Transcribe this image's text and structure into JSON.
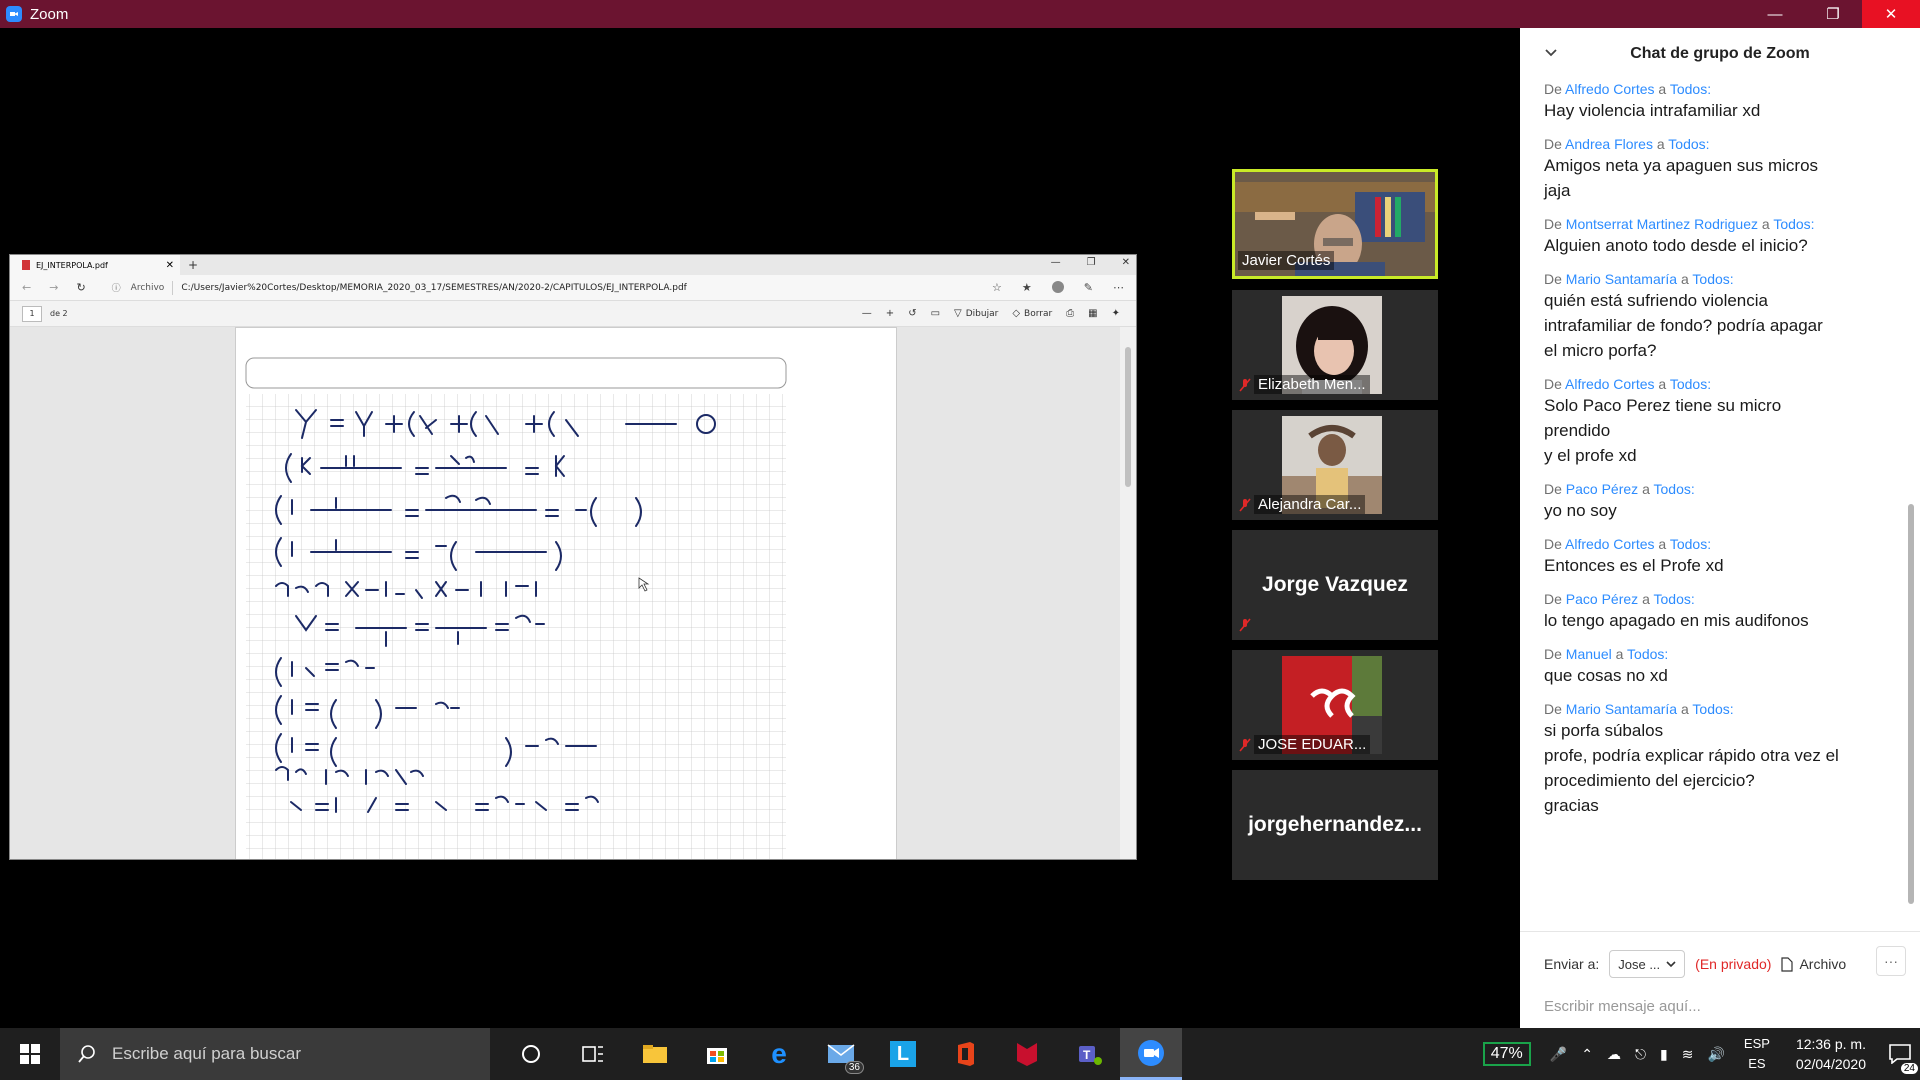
{
  "zoom": {
    "title": "Zoom"
  },
  "browser": {
    "tab_title": "EJ_INTERPOLA.pdf",
    "address_label": "Archivo",
    "url": "C:/Users/Javier%20Cortes/Desktop/MEMORIA_2020_03_17/SEMESTRES/AN/2020-2/CAPITULOS/EJ_INTERPOLA.pdf",
    "page_number": "1",
    "page_of": "de 2",
    "draw_label": "Dibujar",
    "erase_label": "Borrar"
  },
  "participants": [
    {
      "name": "Javier Cortés",
      "active": true,
      "has_video": true
    },
    {
      "name": "Elizabeth Men...",
      "muted": true,
      "has_video": true
    },
    {
      "name": "Alejandra Car...",
      "muted": true,
      "has_video": true
    },
    {
      "name": "Jorge Vazquez",
      "muted": true,
      "has_video": false
    },
    {
      "name": "JOSE EDUAR...",
      "muted": true,
      "has_video": true
    },
    {
      "name": "jorgehernandez...",
      "muted": false,
      "has_video": false
    }
  ],
  "chat": {
    "title": "Chat de grupo de Zoom",
    "from_word": "De",
    "to_word": "a",
    "messages": [
      {
        "from": "Alfredo Cortes",
        "to": "Todos:",
        "lines": [
          "Hay violencia intrafamiliar xd"
        ]
      },
      {
        "from": "Andrea Flores",
        "to": "Todos:",
        "lines": [
          "Amigos neta ya apaguen sus micros",
          "jaja"
        ]
      },
      {
        "from": "Montserrat Martinez Rodriguez",
        "to": "Todos:",
        "lines": [
          "Alguien anoto todo desde el inicio?"
        ]
      },
      {
        "from": "Mario Santamaría",
        "to": "Todos:",
        "lines": [
          "quién está sufriendo violencia",
          "intrafamiliar de fondo? podría apagar",
          "el micro porfa?"
        ]
      },
      {
        "from": "Alfredo Cortes",
        "to": "Todos:",
        "lines": [
          "Solo Paco Perez tiene su micro",
          "prendido",
          "y el profe xd"
        ]
      },
      {
        "from": "Paco Pérez",
        "to": "Todos:",
        "lines": [
          "yo no soy"
        ]
      },
      {
        "from": "Alfredo Cortes",
        "to": "Todos:",
        "lines": [
          "Entonces es el Profe xd"
        ]
      },
      {
        "from": "Paco Pérez",
        "to": "Todos:",
        "lines": [
          "lo tengo apagado en mis audifonos"
        ]
      },
      {
        "from": "Manuel",
        "to": "Todos:",
        "lines": [
          "que cosas no xd"
        ]
      },
      {
        "from": "Mario Santamaría",
        "to": "Todos:",
        "lines": [
          "si porfa súbalos",
          "profe, podría explicar rápido otra vez el",
          "procedimiento del ejercicio?",
          "gracias"
        ]
      }
    ],
    "send_to_label": "Enviar a:",
    "recipient": "Jose ...",
    "private_label": "(En privado)",
    "file_label": "Archivo",
    "more_label": "···",
    "input_placeholder": "Escribir mensaje aquí..."
  },
  "taskbar": {
    "search_placeholder": "Escribe aquí para buscar",
    "mail_badge": "36",
    "battery": "47%",
    "lang_top": "ESP",
    "lang_bottom": "ES",
    "time": "12:36 p. m.",
    "date": "02/04/2020",
    "notifications": "24"
  },
  "colors": {
    "zoom_titlebar": "#6b1430",
    "chat_link": "#2d8cff",
    "active_speaker": "#c9ea27",
    "private_red": "#e02828"
  }
}
